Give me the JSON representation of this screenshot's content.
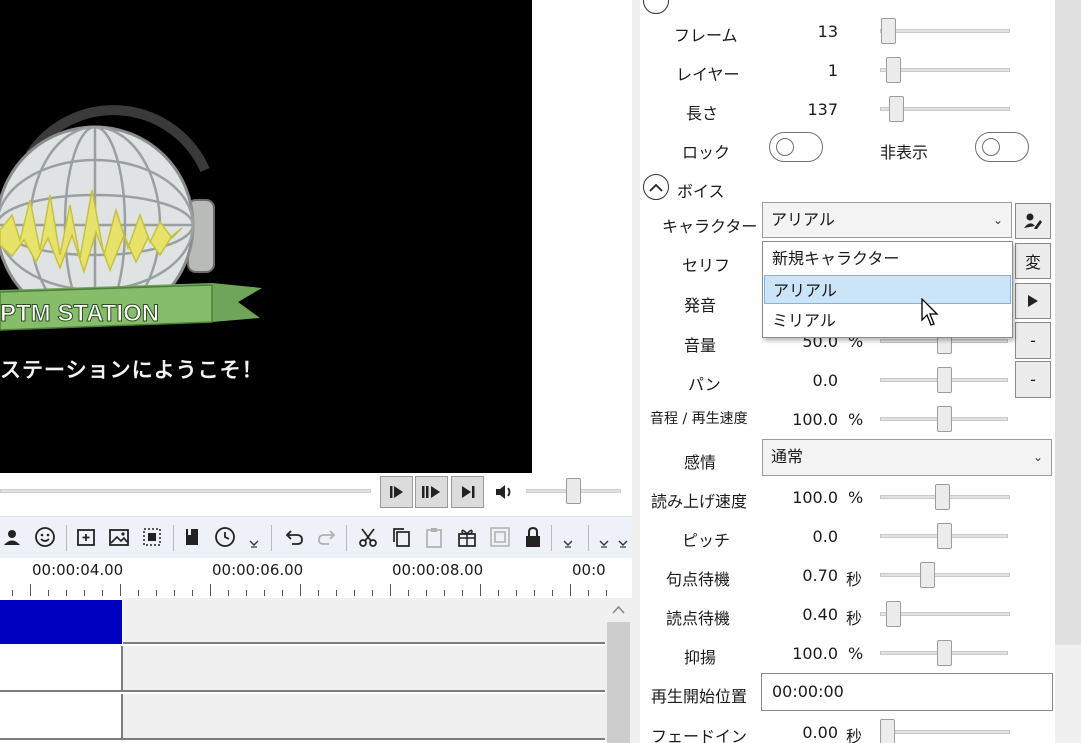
{
  "preview": {
    "banner_text": "PTM STATION",
    "welcome_text": "ステーションにようこそ！"
  },
  "timeline": {
    "ruler_labels": [
      "00:00:04.00",
      "00:00:06.00",
      "00:00:08.00",
      "00:0"
    ]
  },
  "props": {
    "frame_label": "フレーム",
    "frame_value": "13",
    "layer_label": "レイヤー",
    "layer_value": "1",
    "length_label": "長さ",
    "length_value": "137",
    "lock_label": "ロック",
    "hide_label": "非表示",
    "voice_header": "ボイス",
    "character_label": "キャラクター",
    "character_value": "アリアル",
    "serif_label": "セリフ",
    "serif_button": "変",
    "pronounce_label": "発音",
    "volume_label": "音量",
    "volume_value": "50.0",
    "volume_unit": "%",
    "pan_label": "パン",
    "pan_value": "0.0",
    "pitch_speed_label": "音程 / 再生速度",
    "pitch_speed_value": "100.0",
    "pitch_speed_unit": "%",
    "emotion_label": "感情",
    "emotion_value": "通常",
    "read_speed_label": "読み上げ速度",
    "read_speed_value": "100.0",
    "read_speed_unit": "%",
    "pitch_label": "ピッチ",
    "pitch_value": "0.0",
    "period_wait_label": "句点待機",
    "period_wait_value": "0.70",
    "period_wait_unit": "秒",
    "comma_wait_label": "読点待機",
    "comma_wait_value": "0.40",
    "comma_wait_unit": "秒",
    "intonation_label": "抑揚",
    "intonation_value": "100.0",
    "intonation_unit": "%",
    "start_pos_label": "再生開始位置",
    "start_pos_value": "00:00:00",
    "fadein_label": "フェードイン",
    "fadein_value": "0.00",
    "fadein_unit": "秒",
    "minus_label": "-"
  },
  "dropdown": {
    "items": [
      "新規キャラクター",
      "アリアル",
      "ミリアル"
    ],
    "selected_index": 1
  },
  "sliders": {
    "frame": 0.01,
    "layer": 0.05,
    "length": 0.08,
    "volume": 0.5,
    "pan": 0.5,
    "pitch_speed": 0.5,
    "read_speed": 0.48,
    "pitch": 0.5,
    "period_wait": 0.35,
    "comma_wait": 0.05,
    "intonation": 0.5,
    "fadein": 0.0,
    "volume_master": 0.5
  }
}
